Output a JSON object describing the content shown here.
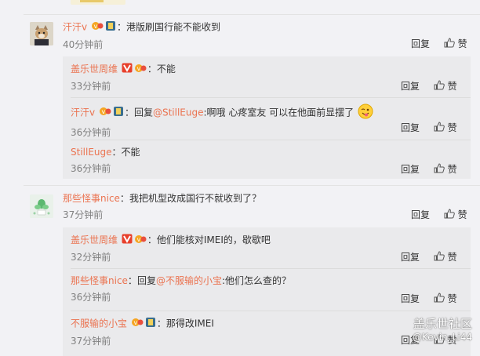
{
  "comments": [
    {
      "user": "汗汗v",
      "text": "港版刷国行能不能收到",
      "time": "40分钟前",
      "reply_label": "回复",
      "like_label": "赞",
      "replies": [
        {
          "user": "盖乐世周维",
          "text": "不能",
          "time": "33分钟前",
          "reply_label": "回复",
          "like_label": "赞"
        },
        {
          "user": "汗汗v",
          "reply_prefix": "回复",
          "mention": "@StillEuge",
          "text": "啊哦 心疼室友  可以在他面前显摆了",
          "time": "36分钟前",
          "reply_label": "回复",
          "like_label": "赞"
        },
        {
          "user": "StillEuge",
          "text": "不能",
          "time": "36分钟前",
          "reply_label": "回复",
          "like_label": "赞"
        }
      ]
    },
    {
      "user": "那些怪事nice",
      "text": "我把机型改成国行不就收到了？",
      "time": "37分钟前",
      "reply_label": "回复",
      "like_label": "赞",
      "replies": [
        {
          "user": "盖乐世周维",
          "text": "他们能核对IMEI的，歇歇吧",
          "time": "32分钟前",
          "reply_label": "回复",
          "like_label": "赞"
        },
        {
          "user": "那些怪事nice",
          "reply_prefix": "回复",
          "mention": "@不服输的小宝",
          "text": "他们怎么查的？",
          "time": "36分钟前",
          "reply_label": "回复",
          "like_label": "赞"
        },
        {
          "user": "不服输的小宝",
          "text": "那得改IMEI",
          "time": "37分钟前",
          "reply_label": "回复",
          "like_label": "赞"
        }
      ]
    }
  ],
  "watermark": {
    "line1": "盖乐世社区",
    "line2": "@Kevin_Li44"
  },
  "colors": {
    "username": "#eb7350",
    "time": "#808080",
    "reply_bg": "#eaeaec",
    "page_bg": "#f2f2f5"
  }
}
